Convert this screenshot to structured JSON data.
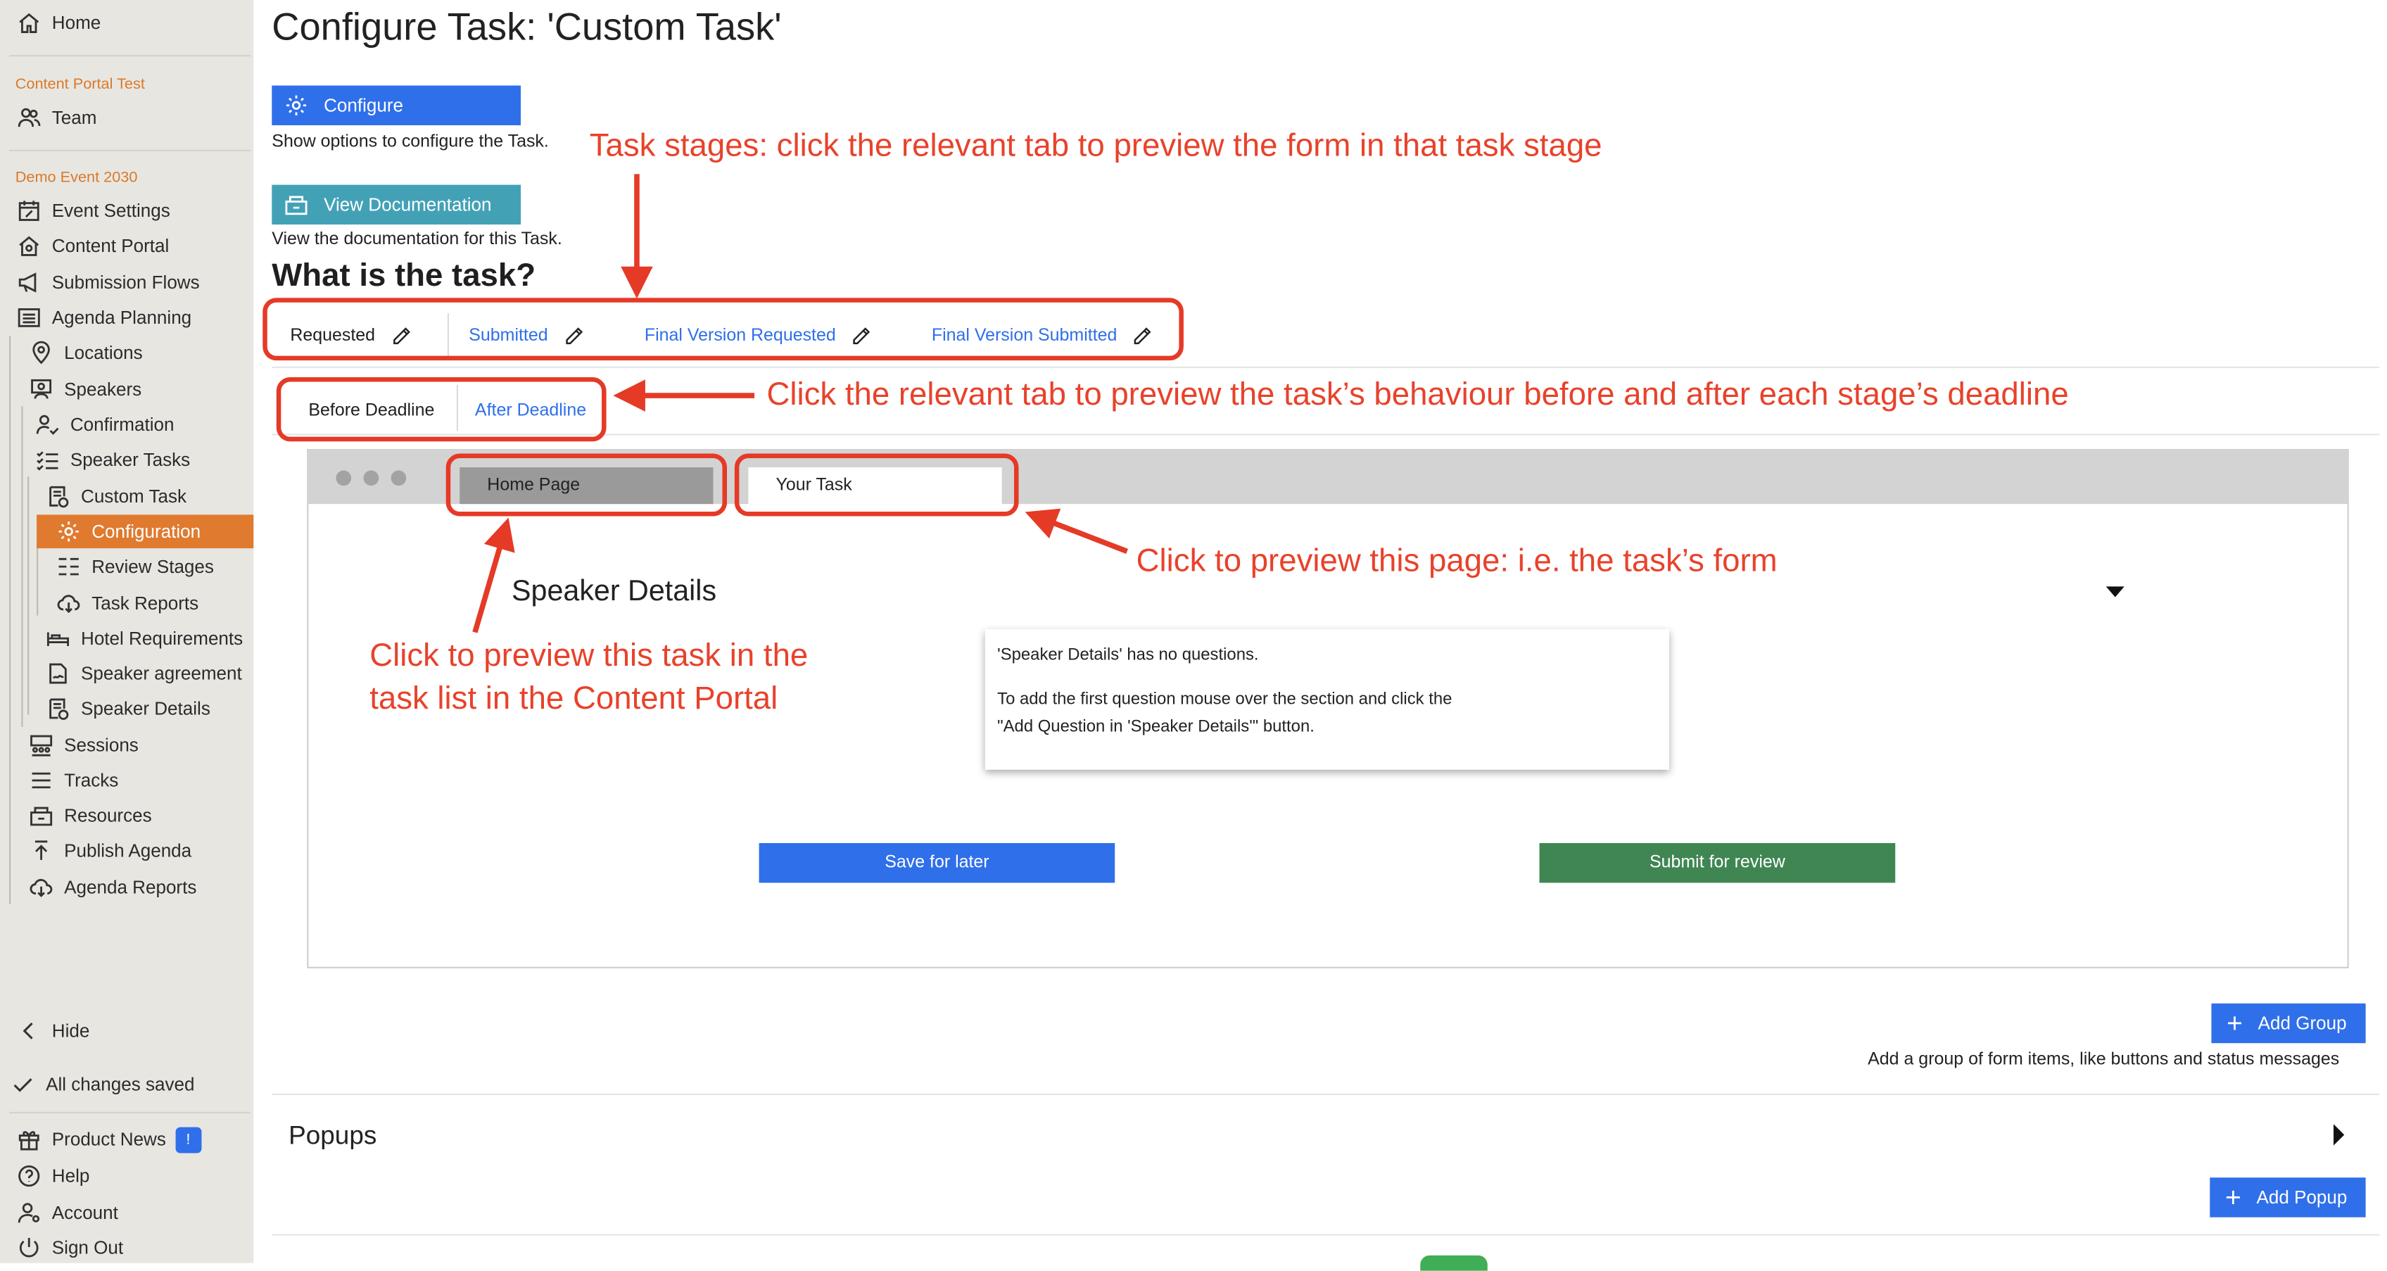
{
  "colors": {
    "sidebar_bg": "#e8e6e1",
    "section_heading": "#d97a2b",
    "active_item": "#e07a2f",
    "primary_blue": "#2f6fea",
    "teal": "#43a1b6",
    "green": "#3f8653",
    "annotation_red": "#e8422b"
  },
  "sidebar": {
    "home": "Home",
    "section1_heading": "Content Portal Test",
    "team": "Team",
    "section2_heading": "Demo Event 2030",
    "items": [
      {
        "label": "Event Settings",
        "icon": "calendar-edit-icon"
      },
      {
        "label": "Content Portal",
        "icon": "portal-home-icon"
      },
      {
        "label": "Submission Flows",
        "icon": "megaphone-icon"
      },
      {
        "label": "Agenda Planning",
        "icon": "list-icon"
      },
      {
        "label": "Locations",
        "icon": "location-pin-icon"
      },
      {
        "label": "Speakers",
        "icon": "speakers-icon"
      },
      {
        "label": "Confirmation",
        "icon": "user-check-icon"
      },
      {
        "label": "Speaker Tasks",
        "icon": "task-list-icon"
      },
      {
        "label": "Custom Task",
        "icon": "form-icon"
      },
      {
        "label": "Configuration",
        "icon": "gear-icon"
      },
      {
        "label": "Review Stages",
        "icon": "review-icon"
      },
      {
        "label": "Task Reports",
        "icon": "cloud-download-icon"
      },
      {
        "label": "Hotel Requirements",
        "icon": "bed-icon"
      },
      {
        "label": "Speaker agreement",
        "icon": "signature-icon"
      },
      {
        "label": "Speaker Details",
        "icon": "form-icon"
      },
      {
        "label": "Sessions",
        "icon": "sessions-icon"
      },
      {
        "label": "Tracks",
        "icon": "tracks-icon"
      },
      {
        "label": "Resources",
        "icon": "resources-icon"
      },
      {
        "label": "Publish Agenda",
        "icon": "publish-icon"
      },
      {
        "label": "Agenda Reports",
        "icon": "cloud-download-icon"
      }
    ],
    "hide": "Hide",
    "saved": "All changes saved",
    "product_news": "Product News",
    "product_news_badge": "!",
    "help": "Help",
    "account": "Account",
    "sign_out": "Sign Out"
  },
  "main": {
    "title": "Configure Task: 'Custom Task'",
    "configure_button": "Configure",
    "configure_note": "Show options to configure the Task.",
    "docs_button": "View Documentation",
    "docs_note": "View the documentation for this Task.",
    "section_heading": "What is the task?",
    "stage_tabs": [
      "Requested",
      "Submitted",
      "Final Version Requested",
      "Final Version Submitted"
    ],
    "deadline_tabs": [
      "Before Deadline",
      "After Deadline"
    ],
    "preview": {
      "tabs": [
        "Home Page",
        "Your Task"
      ],
      "section_title": "Speaker Details",
      "info_line1": "'Speaker Details' has no questions.",
      "info_line2": "To add the first question mouse over the section and click the",
      "info_line3": "\"Add Question in 'Speaker Details'\" button.",
      "save_button": "Save for later",
      "submit_button": "Submit for review"
    },
    "add_group_button": "Add Group",
    "add_group_note": "Add a group of form items, like buttons and status messages",
    "popups_heading": "Popups",
    "add_popup_button": "Add Popup"
  },
  "annotations": {
    "task_stages": "Task stages: click the relevant tab to preview the form in that task stage",
    "deadline": "Click the relevant tab to preview the task’s behaviour before and after each stage’s deadline",
    "your_task": "Click to preview this page: i.e. the task’s form",
    "home_line1": "Click to preview this task in the",
    "home_line2": "task list in the Content Portal"
  }
}
